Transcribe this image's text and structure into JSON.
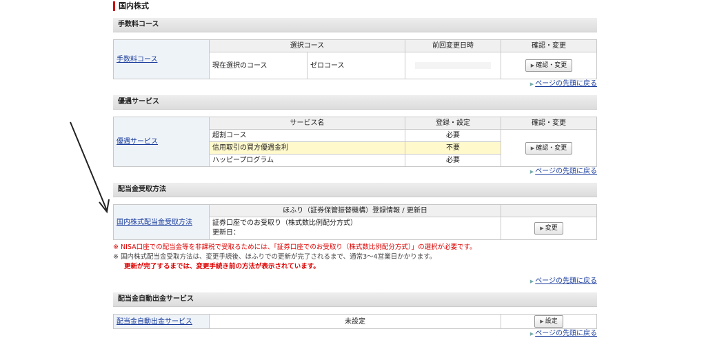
{
  "page_title": "国内株式",
  "commission": {
    "heading": "手数料コース",
    "label_link": "手数料コース",
    "headers": [
      "選択コース",
      "前回変更日時",
      "確認・変更"
    ],
    "row_label": "現在選択のコース",
    "row_value": "ゼロコース",
    "button": "確認・変更"
  },
  "preferential": {
    "heading": "優遇サービス",
    "label_link": "優遇サービス",
    "headers": [
      "サービス名",
      "登録・設定",
      "確認・変更"
    ],
    "rows": [
      {
        "name": "超割コース",
        "status": "必要"
      },
      {
        "name": "信用取引の買方優遇金利",
        "status": "不要"
      },
      {
        "name": "ハッピープログラム",
        "status": "必要"
      }
    ],
    "button": "確認・変更"
  },
  "dividend": {
    "heading": "配当金受取方法",
    "label_link": "国内株式配当金受取方法",
    "header": "ほふり（証券保管振替機構）登録情報 / 更新日",
    "method": "証券口座でのお受取り（株式数比例配分方式）",
    "update_label": "更新日：",
    "button": "変更",
    "note1": "※ NISA口座での配当金等を非課税で受取るためには、「証券口座でのお受取り（株式数比例配分方式）」の選択が必要です。",
    "note2": "※ 国内株式配当金受取方法は、変更手続後、ほふりでの更新が完了されるまで、通常3〜4営業日かかります。",
    "note3": "更新が完了するまでは、変更手続き前の方法が表示されています。"
  },
  "auto_withdraw": {
    "heading": "配当金自動出金サービス",
    "label_link": "配当金自動出金サービス",
    "status": "未設定",
    "button": "設定"
  },
  "back_to_top": "ページの先頭に戻る"
}
